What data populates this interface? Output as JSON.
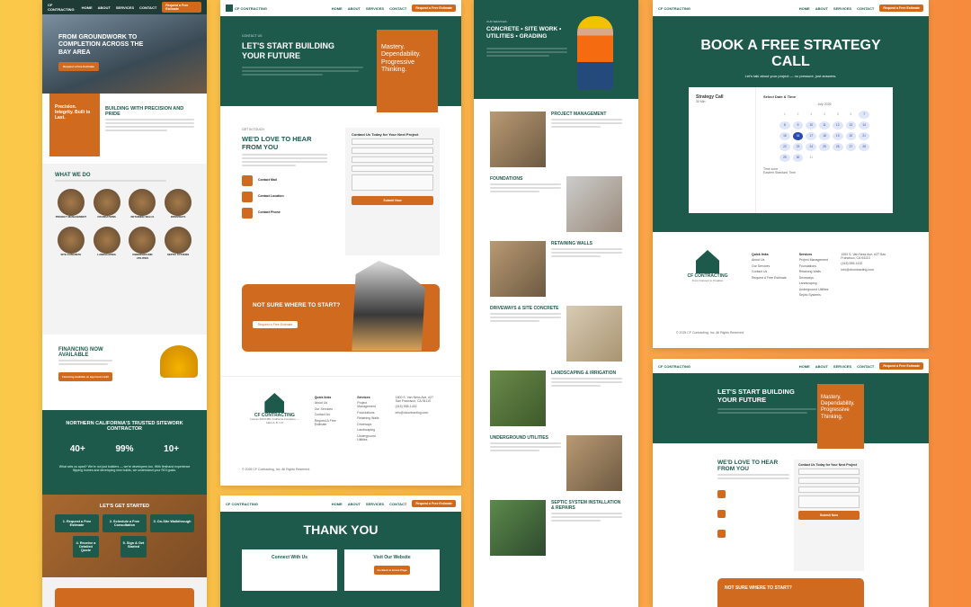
{
  "nav": {
    "home": "HOME",
    "about": "ABOUT",
    "services": "SERVICES",
    "contact": "CONTACT",
    "cta": "Request a Free Estimate"
  },
  "brand": {
    "name": "CF CONTRACTING",
    "suffix": "INC.",
    "tagline": "From Concept to Creation",
    "license": "License #1067489 | California Contractor — Class A, B, C-8",
    "serving": "Serving Residential And Commercial Clients In Marin, San Francisco, And San Mateo Counties"
  },
  "p1": {
    "hero": "FROM GROUNDWORK TO COMPLETION ACROSS THE BAY AREA",
    "hero_btn": "Request a Free Estimate",
    "precision": "Precision. Integrity. Built to Last.",
    "build_title": "BUILDING WITH PRECISION AND PRIDE",
    "what_title": "WHAT WE DO",
    "services": [
      "PROJECT MANAGEMENT",
      "FOUNDATIONS",
      "RETAINING WALLS",
      "DRIVEWAYS",
      "SITE CONCRETE",
      "LANDSCAPING",
      "UNDERGROUND UTILITIES",
      "SEPTIC SYSTEMS"
    ],
    "financing_title": "FINANCING NOW AVAILABLE",
    "financing_btn": "Financing available on approved credit",
    "trusted": "NORTHERN CALIFORNIA'S TRUSTED SITEWORK CONTRACTOR",
    "stats": [
      "40+",
      "99%",
      "10+"
    ],
    "apart": "What sets us apart? We're not just builders — we're developers too. With firsthand experience flipping homes and developing new builds, we understand your ROI goals.",
    "started": "LET'S GET STARTED",
    "steps": [
      "1. Request a Free Estimate",
      "2. Schedule a Free Consultation",
      "3. On-Site Walkthrough",
      "4. Receive a Detailed Quote",
      "5. Sign & Get Started"
    ]
  },
  "p2": {
    "eyebrow": "CONTACT US",
    "title": "LET'S START BUILDING YOUR FUTURE",
    "mastery": "Mastery. Dependability. Progressive Thinking.",
    "get_in_touch": "GET IN TOUCH",
    "love": "WE'D LOVE TO HEAR FROM YOU",
    "contacts": [
      "Contact Mail",
      "Contact Location",
      "Contact Phone"
    ],
    "form_title": "Contact Us Today for Your Next Project",
    "submit": "Submit Now",
    "not_sure": "NOT SURE WHERE TO START?",
    "not_sure_btn": "Request a Free Estimate"
  },
  "footer": {
    "quick": "Quick links",
    "quick_items": [
      "About Us",
      "Our Services",
      "Contact Us",
      "Request A Free Estimate"
    ],
    "services": "Services",
    "service_items": [
      "Project Management",
      "Foundations",
      "Retaining Walls",
      "Driveways",
      "Landscaping",
      "Underground Utilities",
      "Septic Systems"
    ],
    "address": "1500 S. Van Ness Ave, #27 San Francisco, CA 94110",
    "phone": "(415) 555-1432",
    "email": "info@cfcontracting.com",
    "copyright": "© 2025 CF Contracting, Inc. All Rights Reserved."
  },
  "p2b": {
    "thanks": "THANK YOU",
    "connect": "Connect With Us",
    "visit": "Visit Our Website",
    "visit_btn": "Go Back to Home Page"
  },
  "p3": {
    "eyebrow": "OUR SERVICES",
    "title": "CONCRETE • SITE WORK • UTILITIES • GRADING",
    "sections": [
      "PROJECT MANAGEMENT",
      "FOUNDATIONS",
      "RETAINING WALLS",
      "DRIVEWAYS & SITE CONCRETE",
      "LANDSCAPING & IRRIGATION",
      "UNDERGROUND UTILITIES",
      "SEPTIC SYSTEM INSTALLATION & REPAIRS"
    ]
  },
  "p4": {
    "title": "BOOK A FREE STRATEGY CALL",
    "sub": "Let's talk about your project — no pressure, just answers.",
    "call": "Strategy Call",
    "duration": "30 Min",
    "select": "Select Date & Time",
    "month": "July 2025",
    "tz_label": "Time zone",
    "tz": "Eastern Standard Time",
    "copyright": "© 2025 CF Contracting, Inc. All Rights Reserved."
  },
  "colors": {
    "teal": "#1e5a4c",
    "orange": "#cf6a1f"
  }
}
